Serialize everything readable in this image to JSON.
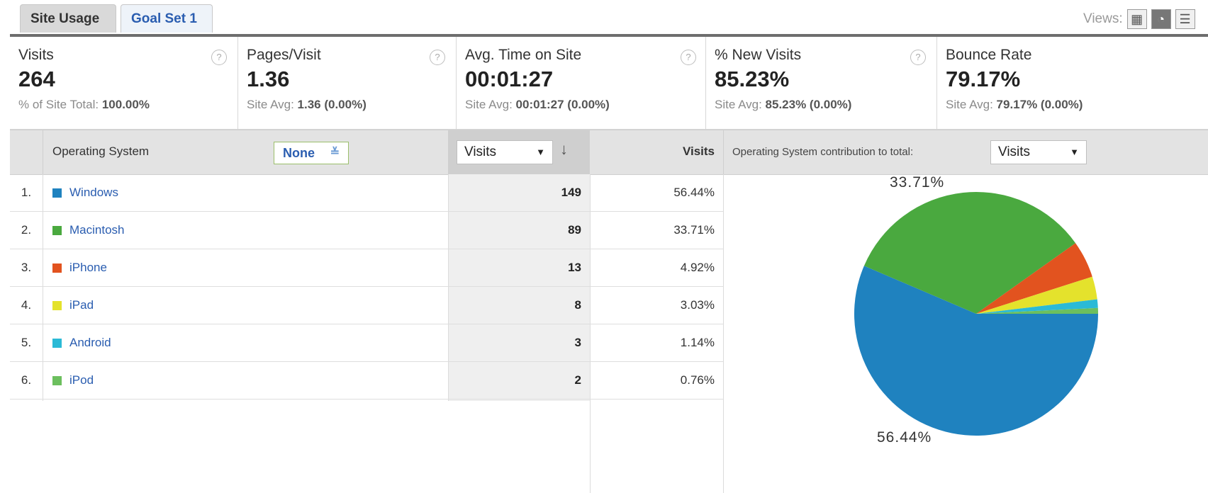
{
  "tabs": [
    {
      "label": "Site Usage",
      "active": true
    },
    {
      "label": "Goal Set 1",
      "active": false
    }
  ],
  "views": {
    "label": "Views:",
    "icons": [
      "grid-view-icon",
      "pie-view-icon",
      "list-view-icon"
    ]
  },
  "scorecard": [
    {
      "name": "Visits",
      "value": "264",
      "sub_label": "% of Site Total:",
      "sub_value": "100.00%"
    },
    {
      "name": "Pages/Visit",
      "value": "1.36",
      "sub_label": "Site Avg:",
      "sub_value": "1.36 (0.00%)"
    },
    {
      "name": "Avg. Time on Site",
      "value": "00:01:27",
      "sub_label": "Site Avg:",
      "sub_value": "00:01:27 (0.00%)"
    },
    {
      "name": "% New Visits",
      "value": "85.23%",
      "sub_label": "Site Avg:",
      "sub_value": "85.23% (0.00%)"
    },
    {
      "name": "Bounce Rate",
      "value": "79.17%",
      "sub_label": "Site Avg:",
      "sub_value": "79.17% (0.00%)"
    }
  ],
  "table": {
    "dimension_header": "Operating System",
    "secondary_dimension": "None",
    "sort_metric": "Visits",
    "visits_header": "Visits",
    "contribution_label": "Operating System contribution to total:",
    "contribution_metric": "Visits",
    "rows": [
      {
        "rank": "1.",
        "os": "Windows",
        "visits": "149",
        "pct": "56.44%",
        "color": "#1f82bf"
      },
      {
        "rank": "2.",
        "os": "Macintosh",
        "visits": "89",
        "pct": "33.71%",
        "color": "#4aa93f"
      },
      {
        "rank": "3.",
        "os": "iPhone",
        "visits": "13",
        "pct": "4.92%",
        "color": "#e2531f"
      },
      {
        "rank": "4.",
        "os": "iPad",
        "visits": "8",
        "pct": "3.03%",
        "color": "#e4e22c"
      },
      {
        "rank": "5.",
        "os": "Android",
        "visits": "3",
        "pct": "1.14%",
        "color": "#2bbad6"
      },
      {
        "rank": "6.",
        "os": "iPod",
        "visits": "2",
        "pct": "0.76%",
        "color": "#6cbf5e"
      }
    ]
  },
  "chart_data": {
    "type": "pie",
    "categories": [
      "Windows",
      "Macintosh",
      "iPhone",
      "iPad",
      "Android",
      "iPod"
    ],
    "values": [
      56.44,
      33.71,
      4.92,
      3.03,
      1.14,
      0.76
    ],
    "colors": [
      "#1f82bf",
      "#4aa93f",
      "#e2531f",
      "#e4e22c",
      "#2bbad6",
      "#6cbf5e"
    ],
    "slice_labels": [
      "56.44%",
      "33.71%"
    ]
  }
}
